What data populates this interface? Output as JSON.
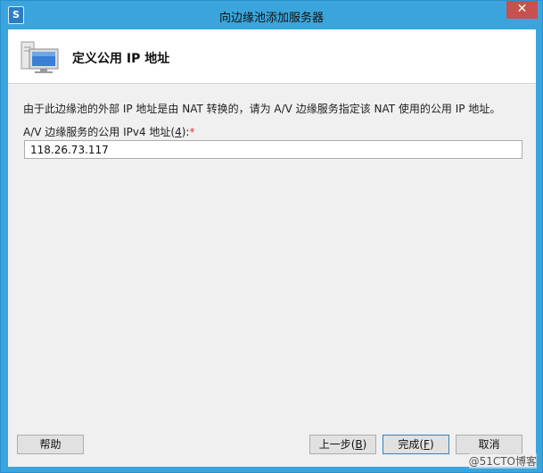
{
  "window": {
    "title": "向边缘池添加服务器",
    "close_glyph": "✕"
  },
  "header": {
    "title": "定义公用 IP 地址",
    "icon": "server-computer-icon"
  },
  "body": {
    "description": "由于此边缘池的外部 IP 地址是由 NAT 转换的，请为 A/V 边缘服务指定该 NAT 使用的公用 IP 地址。",
    "field_label": "A/V 边缘服务的公用 IPv4 地址",
    "field_accel": "4",
    "required_marker": "*",
    "ip_value": "118.26.73.117"
  },
  "buttons": {
    "help": "帮助",
    "back": "上一步",
    "back_accel": "B",
    "finish": "完成",
    "finish_accel": "F",
    "cancel": "取消"
  },
  "watermark": "@51CTO博客",
  "colors": {
    "frame": "#3aa5dc",
    "close_button": "#c7514e",
    "required": "#d23b3b"
  }
}
